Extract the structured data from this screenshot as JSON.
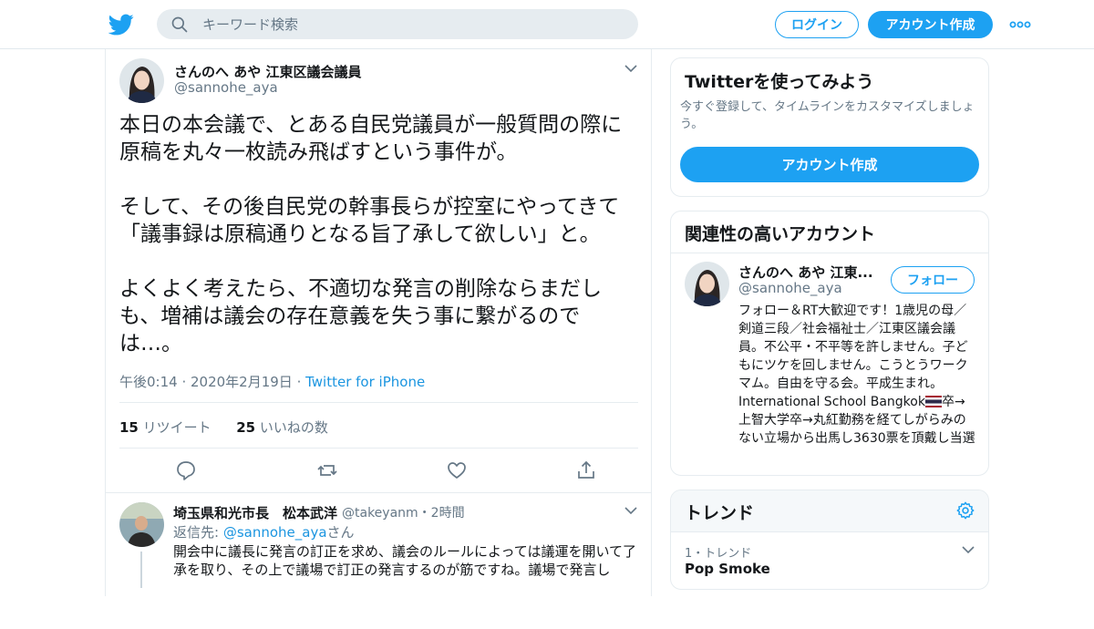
{
  "header": {
    "search_placeholder": "キーワード検索",
    "login_label": "ログイン",
    "signup_label": "アカウント作成"
  },
  "tweet": {
    "name": "さんのへ あや 江東区議会議員",
    "handle": "@sannohe_aya",
    "text": "本日の本会議で、とある自民党議員が一般質問の際に原稿を丸々一枚読み飛ばすという事件が。\n\nそして、その後自民党の幹事長らが控室にやってきて「議事録は原稿通りとなる旨了承して欲しい」と。\n\nよくよく考えたら、不適切な発言の削除ならまだしも、増補は議会の存在意義を失う事に繋がるのでは…。",
    "timestamp": "午後0:14 · 2020年2月19日",
    "separator": " · ",
    "source": "Twitter for iPhone",
    "retweet_count": "15",
    "retweet_label": "リツイート",
    "like_count": "25",
    "like_label": "いいねの数"
  },
  "reply": {
    "name": "埼玉県和光市長　松本武洋",
    "handle": "@takeyanm",
    "time": "・2時間",
    "reply_to_prefix": "返信先: ",
    "reply_to_handle": "@sannohe_aya",
    "reply_to_suffix": "さん",
    "text": "開会中に議長に発言の訂正を求め、議会のルールによっては議運を開いて了承を取り、その上で議場で訂正の発言するのが筋ですね。議場で発言し"
  },
  "signup_card": {
    "title": "Twitterを使ってみよう",
    "description": "今すぐ登録して、タイムラインをカスタマイズしましょう。",
    "button_label": "アカウント作成"
  },
  "related_card": {
    "title": "関連性の高いアカウント",
    "name": "さんのへ あや 江東...",
    "handle": "@sannohe_aya",
    "follow_label": "フォロー",
    "bio_before_flag": "フォロー＆RT大歓迎です！1歳児の母／剣道三段／社会福祉士／江東区議会議員。不公平・不平等を許しません。子どもにツケを回しません。こうとうワークマム。自由を守る会。平成生まれ。International School Bangkok",
    "bio_after_flag": "卒→上智大学卒→丸紅勤務を経てしがらみのない立場から出馬し3630票を頂戴し当選"
  },
  "trends_card": {
    "title": "トレンド",
    "trend_meta": "1・トレンド",
    "trend_name": "Pop Smoke"
  },
  "colors": {
    "accent": "#1da1f2",
    "link": "#1b95e0",
    "muted": "#657786"
  }
}
